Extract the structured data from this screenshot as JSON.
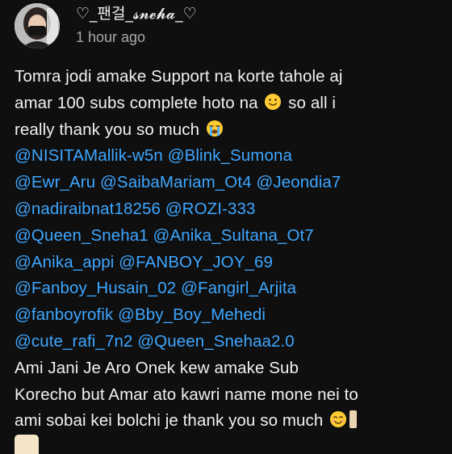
{
  "post": {
    "author": "♡_팬걸_𝓼𝓷𝓮𝓱𝓪_♡",
    "timestamp": "1 hour ago",
    "avatar_icon": "user-avatar-photo",
    "text": {
      "line1": "Tomra jodi amake Support na korte tahole aj",
      "line2_a": "amar 100 subs complete hoto na",
      "line2_b": "so all i",
      "line3_a": "really thank you so much",
      "line13": "Ami Jani Je Aro Onek kew amake Sub",
      "line14": "Korecho but Amar ato kawri name mone nei to",
      "line15_a": "ami sobai kei bolchi je thank you so much"
    },
    "mentions": [
      [
        "@NISITAMallik-w5n",
        "@Blink_Sumona"
      ],
      [
        "@Ewr_Aru",
        "@SaibaMariam_Ot4",
        "@Jeondia7"
      ],
      [
        "@nadiraibnat18256",
        "@ROZI-333"
      ],
      [
        "@Queen_Sneha1",
        "@Anika_Sultana_Ot7"
      ],
      [
        "@Anika_appi",
        "@FANBOY_JOY_69"
      ],
      [
        "@Fanboy_Husain_02",
        "@Fangirl_Arjita"
      ],
      [
        "@fanboyrofik",
        "@Bby_Boy_Mehedi"
      ],
      [
        "@cute_rafi_7n2",
        "@Queen_Snehaa2.0"
      ]
    ],
    "emojis": {
      "after_line2": "slightly-smiling-face-icon",
      "after_line3": "loudly-crying-face-icon",
      "after_line15": "smiling-face-with-smiling-eyes-icon"
    }
  },
  "colors": {
    "background": "#0f0f0f",
    "text": "#f1f1f1",
    "mention": "#3ea6ff",
    "timestamp": "#aaaaaa"
  }
}
